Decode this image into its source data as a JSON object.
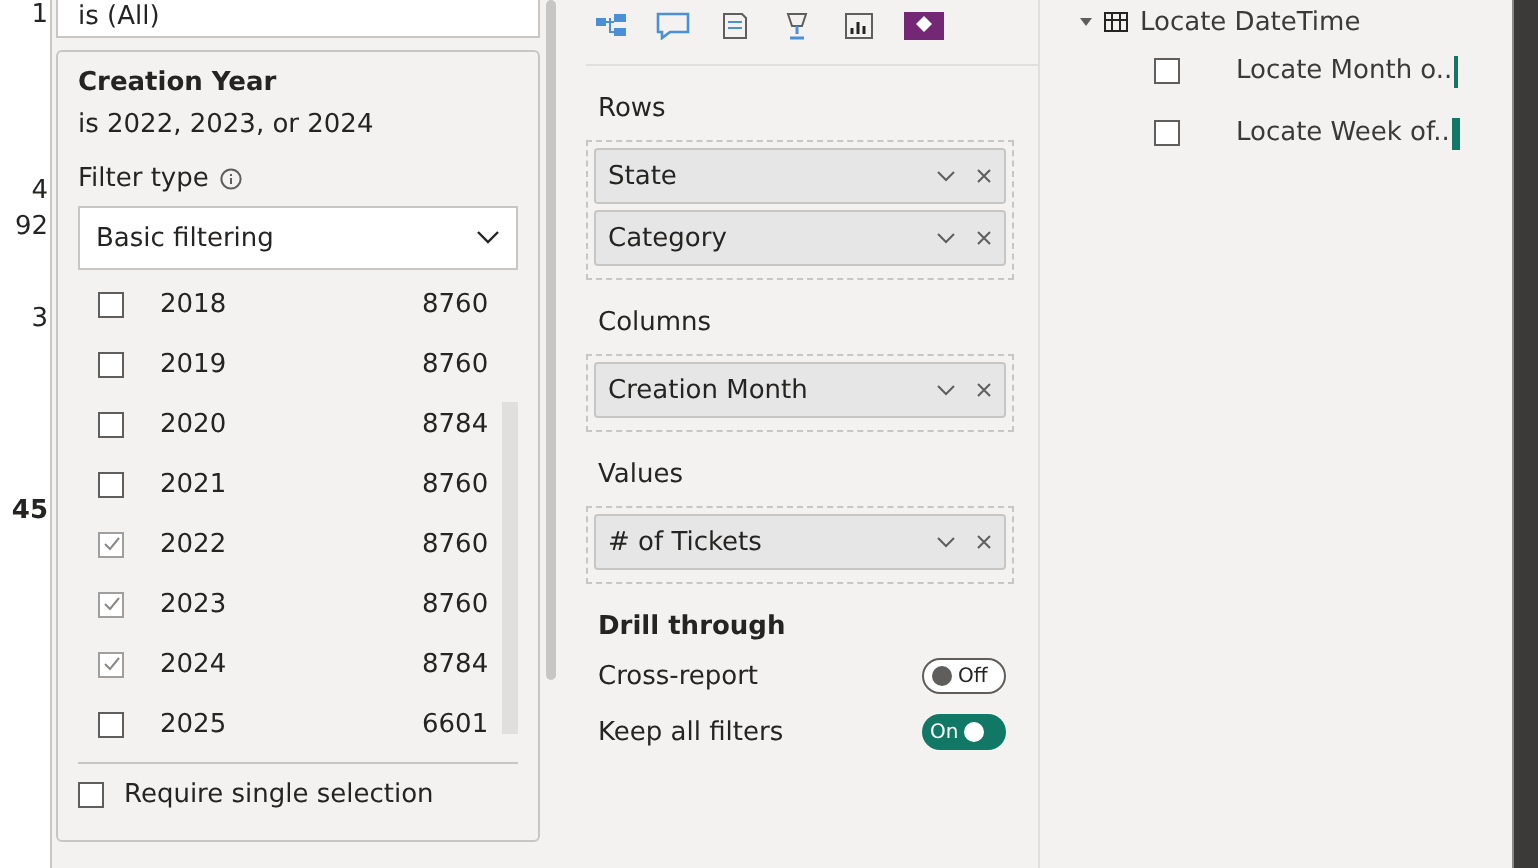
{
  "edge_table": {
    "cells": [
      "1",
      "4",
      "92",
      "3",
      "45"
    ]
  },
  "filters": {
    "previous_card": {
      "summary": "is (All)"
    },
    "card": {
      "title": "Creation Year",
      "summary": "is 2022, 2023, or 2024",
      "filter_type_label": "Filter type",
      "filter_type": "Basic filtering",
      "items": [
        {
          "label": "2018",
          "count": "8760",
          "checked": false
        },
        {
          "label": "2019",
          "count": "8760",
          "checked": false
        },
        {
          "label": "2020",
          "count": "8784",
          "checked": false
        },
        {
          "label": "2021",
          "count": "8760",
          "checked": false
        },
        {
          "label": "2022",
          "count": "8760",
          "checked": true
        },
        {
          "label": "2023",
          "count": "8760",
          "checked": true
        },
        {
          "label": "2024",
          "count": "8784",
          "checked": true
        },
        {
          "label": "2025",
          "count": "6601",
          "checked": false
        }
      ],
      "require_single": {
        "label": "Require single selection",
        "checked": false
      }
    }
  },
  "visualizations": {
    "wells": [
      {
        "title": "Rows",
        "fields": [
          "State",
          "Category"
        ]
      },
      {
        "title": "Columns",
        "fields": [
          "Creation Month"
        ]
      },
      {
        "title": "Values",
        "fields": [
          "# of Tickets"
        ]
      }
    ],
    "drill_through": {
      "title": "Drill through",
      "toggles": [
        {
          "label": "Cross-report",
          "on": false,
          "state_label": "Off"
        },
        {
          "label": "Keep all filters",
          "on": true,
          "state_label": "On"
        }
      ]
    }
  },
  "fields": {
    "table": {
      "name": "Locate DateTime",
      "expanded": true,
      "children": [
        {
          "name": "Locate Month o..",
          "checked": false
        },
        {
          "name": "Locate Week of..",
          "checked": false
        }
      ]
    }
  }
}
